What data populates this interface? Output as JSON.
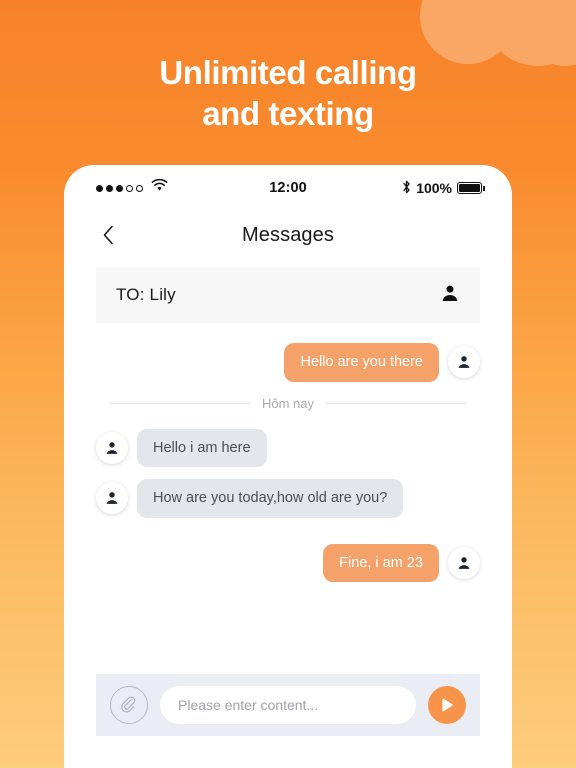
{
  "promo": {
    "headline_line1": "Unlimited calling",
    "headline_line2": "and texting",
    "background_top_color": "#F7822A",
    "background_bottom_color": "#FDCC7C",
    "cloud_color": "#FAA766"
  },
  "status_bar": {
    "signal_dots_filled": 3,
    "signal_dots_hollow": 2,
    "wifi_icon": "wifi-icon",
    "time": "12:00",
    "bluetooth_icon": "bluetooth-icon",
    "battery_percent": "100%",
    "battery_icon": "battery-full-icon"
  },
  "nav_bar": {
    "back_icon": "chevron-left-icon",
    "title": "Messages"
  },
  "to_row": {
    "label": "TO:  Lily",
    "contact_icon": "person-icon"
  },
  "chat": {
    "date_divider": "Hôm nay",
    "messages": [
      {
        "text": "Hello are you there",
        "side": "out",
        "avatar_icon": "person-icon"
      },
      {
        "text": "Hello i am here",
        "side": "in",
        "avatar_icon": "person-icon"
      },
      {
        "text": "How are you today,how old are you?",
        "side": "in",
        "avatar_icon": "person-icon"
      },
      {
        "text": "Fine, i am 23",
        "side": "out",
        "avatar_icon": "person-icon"
      }
    ],
    "outgoing_bubble_color": "#F4A269",
    "incoming_bubble_color": "#E3E6EA"
  },
  "input_bar": {
    "attach_icon": "paperclip-icon",
    "input_value": "",
    "input_placeholder": "Please enter content...",
    "send_icon": "send-play-icon",
    "send_button_color": "#F7944A",
    "bar_background_color": "#EAEDF4"
  }
}
